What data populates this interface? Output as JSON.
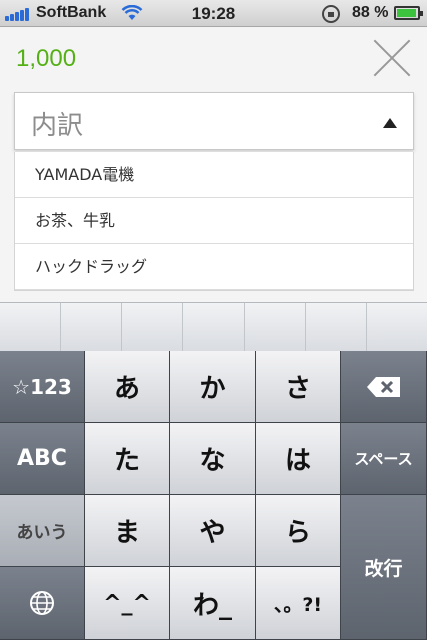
{
  "status_bar": {
    "carrier": "SoftBank",
    "time": "19:28",
    "battery_percent": "88 %",
    "battery_level": 0.88,
    "icons": [
      "signal-icon",
      "wifi-icon",
      "orientation-lock-icon",
      "battery-icon"
    ]
  },
  "form": {
    "amount": "1,000",
    "category_placeholder": "内訳",
    "dropdown_items": [
      "YAMADA電機",
      "お茶、牛乳",
      "ハックドラッグ"
    ]
  },
  "colors": {
    "amount": "#55b016",
    "keyboard_bg": "#2e3239"
  },
  "keyboard": {
    "mode_key": "☆123",
    "abc_key": "ABC",
    "kana_key": "あいう",
    "globe_key": "globe-icon",
    "row1": [
      "あ",
      "か",
      "さ"
    ],
    "row2": [
      "た",
      "な",
      "は"
    ],
    "row3": [
      "ま",
      "や",
      "ら"
    ],
    "row4": [
      "^_^",
      "わ_",
      "、。?!"
    ],
    "delete_key": "delete-icon",
    "space_key": "スペース",
    "return_key": "改行"
  }
}
